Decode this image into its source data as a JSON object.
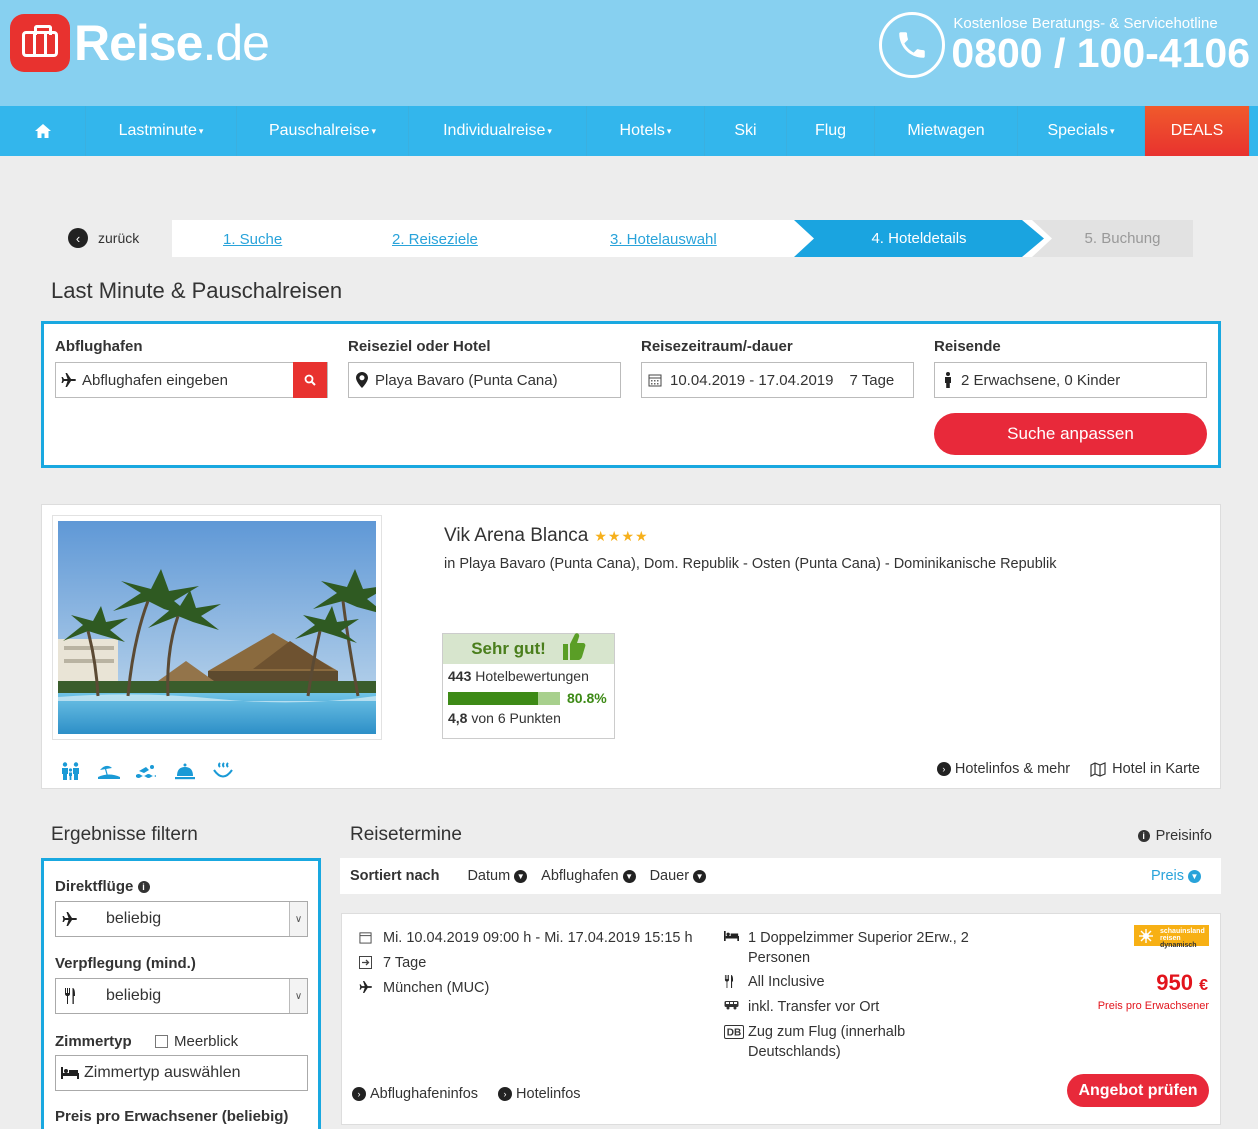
{
  "header": {
    "logo_main": "Reise",
    "logo_tld": ".de",
    "hotline_label": "Kostenlose Beratungs- & Servicehotline",
    "hotline_number": "0800 / 100-4106"
  },
  "nav": {
    "items": [
      {
        "label": "Lastminute",
        "has_menu": true
      },
      {
        "label": "Pauschalreise",
        "has_menu": true
      },
      {
        "label": "Individualreise",
        "has_menu": true
      },
      {
        "label": "Hotels",
        "has_menu": true
      },
      {
        "label": "Ski",
        "has_menu": false
      },
      {
        "label": "Flug",
        "has_menu": false
      },
      {
        "label": "Mietwagen",
        "has_menu": false
      },
      {
        "label": "Specials",
        "has_menu": true
      },
      {
        "label": "DEALS",
        "has_menu": false
      }
    ],
    "caret": "▾"
  },
  "steps": {
    "back": "zurück",
    "items": [
      "1. Suche",
      "2. Reiseziele",
      "3. Hotelauswahl",
      "4. Hoteldetails",
      "5. Buchung"
    ],
    "active_index": 3
  },
  "page_title": "Last Minute & Pauschalreisen",
  "search": {
    "departure_label": "Abflughafen",
    "departure_placeholder": "Abflughafen eingeben",
    "destination_label": "Reiseziel oder Hotel",
    "destination_value": "Playa Bavaro (Punta Cana)",
    "period_label": "Reisezeitraum/-dauer",
    "period_value": "10.04.2019 - 17.04.2019",
    "duration_value": "7 Tage",
    "travellers_label": "Reisende",
    "travellers_value": "2 Erwachsene, 0 Kinder",
    "submit_label": "Suche anpassen"
  },
  "hotel": {
    "name": "Vik Arena Blanca",
    "stars": "★★★★",
    "location": "in Playa Bavaro (Punta Cana), Dom. Republik - Osten (Punta Cana) - Dominikanische Republik",
    "rating_head": "Sehr gut!",
    "reviews_count": "443",
    "reviews_label": "Hotelbewertungen",
    "recommend_pct": "80.8%",
    "recommend_fraction": 0.808,
    "score": "4,8",
    "score_suffix": "von 6 Punkten",
    "amenity_icons": [
      "family-icon",
      "beach-icon",
      "swimming-icon",
      "service-bell-icon",
      "spa-icon"
    ],
    "link_info": "Hotelinfos & mehr",
    "link_map": "Hotel in Karte"
  },
  "filter": {
    "title": "Ergebnisse filtern",
    "direct_label": "Direktflüge",
    "direct_value": "beliebig",
    "board_label": "Verpflegung (mind.)",
    "board_value": "beliebig",
    "room_label": "Zimmertyp",
    "seaview_label": "Meerblick",
    "room_placeholder": "Zimmertyp auswählen",
    "price_label": "Preis pro Erwachsener (beliebig)"
  },
  "results": {
    "title": "Reisetermine",
    "priceinfo": "Preisinfo",
    "sort_label": "Sortiert nach",
    "sort_items": [
      "Datum",
      "Abflughafen",
      "Dauer"
    ],
    "sort_active": "Preis"
  },
  "offer": {
    "dates": "Mi. 10.04.2019 09:00 h - Mi. 17.04.2019 15:15 h",
    "duration": "7 Tage",
    "airport": "München (MUC)",
    "room_line1": "1 Doppelzimmer Superior 2Erw., 2",
    "room_line2": "Personen",
    "board": "All Inclusive",
    "transfer": "inkl. Transfer vor Ort",
    "train_line1": "Zug zum Flug (innerhalb",
    "train_line2": "Deutschlands)",
    "operator_line1": "schauinsland",
    "operator_line2": "reisen",
    "operator_line3": "dynamisch",
    "price": "950",
    "currency": "€",
    "price_note": "Preis pro Erwachsener",
    "link_airport": "Abflughafeninfos",
    "link_hotel": "Hotelinfos",
    "cta": "Angebot prüfen"
  },
  "colors": {
    "header_bg": "#87d0f0",
    "nav_bg": "#33b6ec",
    "accent_blue": "#19a8e0",
    "cta_red": "#e8293a",
    "rating_green": "#3d8a16",
    "price_red": "#e2141c"
  }
}
